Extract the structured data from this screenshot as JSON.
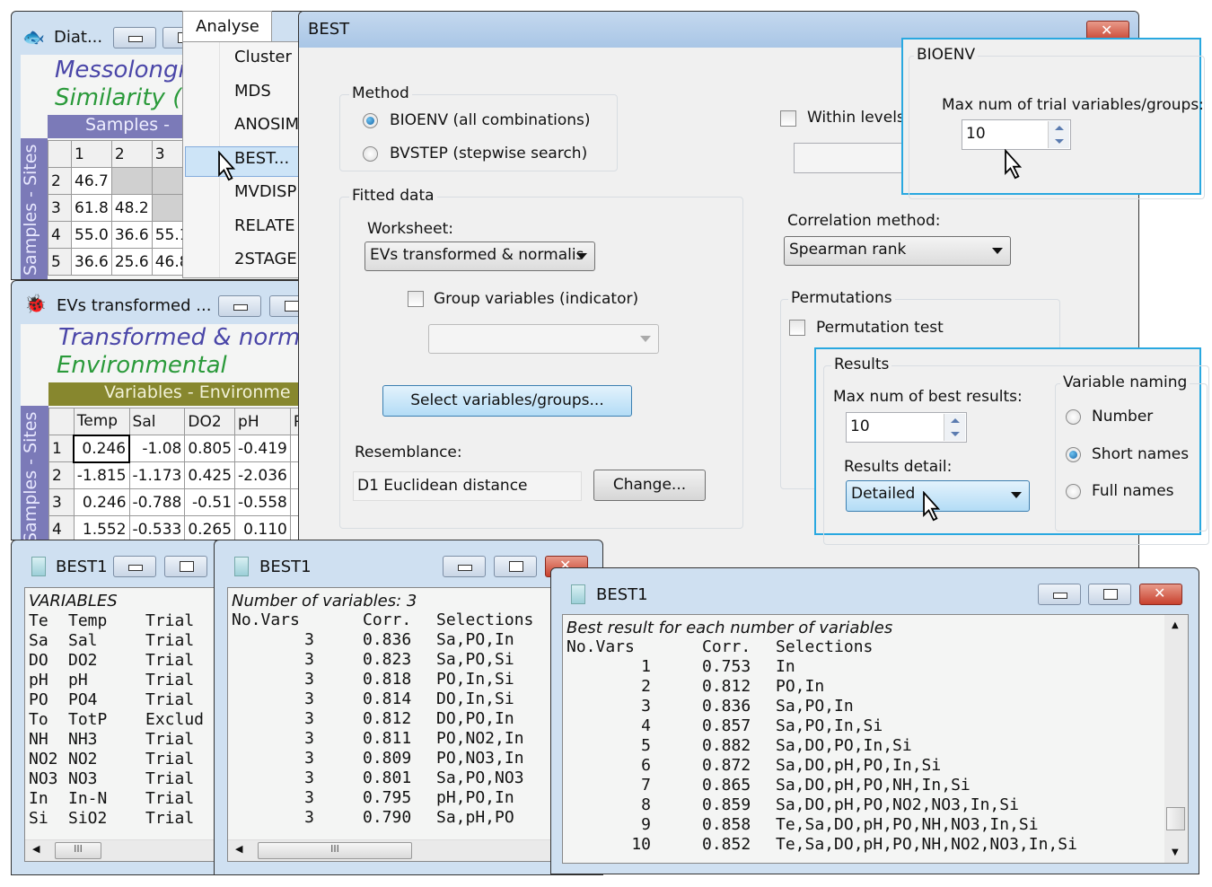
{
  "diat_window": {
    "title": "Diat...",
    "heading1": "Messolongi",
    "heading2": "Similarity (",
    "col_header": "Samples -",
    "row_header": "Samples - Sites",
    "columns": [
      "1",
      "2",
      "3"
    ],
    "rows": [
      {
        "label": "2",
        "cells": [
          "46.7",
          "",
          ""
        ]
      },
      {
        "label": "3",
        "cells": [
          "61.8",
          "48.2",
          ""
        ]
      },
      {
        "label": "4",
        "cells": [
          "55.0",
          "36.6",
          "55.1"
        ]
      },
      {
        "label": "5",
        "cells": [
          "36.6",
          "25.6",
          "46.8"
        ]
      }
    ]
  },
  "analyse_menu": {
    "title": "Analyse",
    "items": [
      "Cluster",
      "MDS",
      "ANOSIM",
      "BEST...",
      "MVDISP",
      "RELATE",
      "2STAGE"
    ],
    "highlighted": "BEST..."
  },
  "evs_window": {
    "title": "EVs transformed ...",
    "heading1": "Transformed & norma",
    "heading2": "Environmental",
    "col_header": "Variables - Environme",
    "row_header": "Samples - Sites",
    "columns": [
      "Temp",
      "Sal",
      "DO2",
      "pH",
      "P"
    ],
    "rows": [
      {
        "label": "1",
        "cells": [
          "0.246",
          "-1.08",
          "0.805",
          "-0.419",
          "-"
        ]
      },
      {
        "label": "2",
        "cells": [
          "-1.815",
          "-1.173",
          "0.425",
          "-2.036",
          "-"
        ]
      },
      {
        "label": "3",
        "cells": [
          "0.246",
          "-0.788",
          "-0.51",
          "-0.558",
          "-"
        ]
      },
      {
        "label": "4",
        "cells": [
          "1.552",
          "-0.533",
          "0.265",
          "0.110",
          ""
        ]
      }
    ]
  },
  "best_dialog": {
    "title": "BEST",
    "method": {
      "label": "Method",
      "options": [
        "BIOENV (all combinations)",
        "BVSTEP (stepwise search)"
      ],
      "selected": 0
    },
    "fitted_data": {
      "label": "Fitted data",
      "worksheet_label": "Worksheet:",
      "worksheet_value": "EVs transformed & normalis",
      "group_variables_label": "Group variables (indicator)",
      "group_variables_checked": false,
      "group_dropdown_value": "",
      "select_button": "Select variables/groups...",
      "resemblance_label": "Resemblance:",
      "resemblance_value": "D1 Euclidean distance",
      "change_button": "Change..."
    },
    "within_levels_label": "Within levels",
    "within_levels_checked": false,
    "correlation_label": "Correlation method:",
    "correlation_value": "Spearman rank",
    "permutations": {
      "label": "Permutations",
      "test_label": "Permutation test",
      "test_checked": false
    },
    "bioenv": {
      "label": "BIOENV",
      "max_trial_label": "Max num of trial variables/groups:",
      "max_trial_value": "10"
    },
    "results": {
      "label": "Results",
      "max_best_label": "Max num of best results:",
      "max_best_value": "10",
      "detail_label": "Results detail:",
      "detail_value": "Detailed",
      "naming": {
        "label": "Variable naming",
        "options": [
          "Number",
          "Short names",
          "Full names"
        ],
        "selected": 1
      }
    }
  },
  "best1_vars": {
    "title": "BEST1",
    "heading": "VARIABLES",
    "rows": [
      [
        "Te",
        "Temp",
        "Trial"
      ],
      [
        "Sa",
        "Sal",
        "Trial"
      ],
      [
        "DO",
        "DO2",
        "Trial"
      ],
      [
        "pH",
        "pH",
        "Trial"
      ],
      [
        "PO",
        "PO4",
        "Trial"
      ],
      [
        "To",
        "TotP",
        "Exclud"
      ],
      [
        "NH",
        "NH3",
        "Trial"
      ],
      [
        "NO2",
        "NO2",
        "Trial"
      ],
      [
        "NO3",
        "NO3",
        "Trial"
      ],
      [
        "In",
        "In-N",
        "Trial"
      ],
      [
        "Si",
        "SiO2",
        "Trial"
      ]
    ]
  },
  "best1_three": {
    "title": "BEST1",
    "heading": "Number of variables: 3",
    "columns": [
      "No.Vars",
      "Corr.",
      "Selections"
    ],
    "rows": [
      [
        "3",
        "0.836",
        "Sa,PO,In"
      ],
      [
        "3",
        "0.823",
        "Sa,PO,Si"
      ],
      [
        "3",
        "0.818",
        "PO,In,Si"
      ],
      [
        "3",
        "0.814",
        "DO,In,Si"
      ],
      [
        "3",
        "0.812",
        "DO,PO,In"
      ],
      [
        "3",
        "0.811",
        "PO,NO2,In"
      ],
      [
        "3",
        "0.809",
        "PO,NO3,In"
      ],
      [
        "3",
        "0.801",
        "Sa,PO,NO3"
      ],
      [
        "3",
        "0.795",
        "pH,PO,In"
      ],
      [
        "3",
        "0.790",
        "Sa,pH,PO"
      ]
    ]
  },
  "best1_best": {
    "title": "BEST1",
    "heading": "Best result for each number of variables",
    "columns": [
      "No.Vars",
      "Corr.",
      "Selections"
    ],
    "rows": [
      [
        "1",
        "0.753",
        "In"
      ],
      [
        "2",
        "0.812",
        "PO,In"
      ],
      [
        "3",
        "0.836",
        "Sa,PO,In"
      ],
      [
        "4",
        "0.857",
        "Sa,PO,In,Si"
      ],
      [
        "5",
        "0.882",
        "Sa,DO,PO,In,Si"
      ],
      [
        "6",
        "0.872",
        "Sa,DO,pH,PO,In,Si"
      ],
      [
        "7",
        "0.865",
        "Sa,DO,pH,PO,NH,In,Si"
      ],
      [
        "8",
        "0.859",
        "Sa,DO,pH,PO,NO2,NO3,In,Si"
      ],
      [
        "9",
        "0.858",
        "Te,Sa,DO,pH,PO,NH,NO3,In,Si"
      ],
      [
        "10",
        "0.852",
        "Te,Sa,DO,pH,PO,NH,NO2,NO3,In,Si"
      ]
    ]
  },
  "colors": {
    "callout": "#29a8e0",
    "samples_bar": "#7b7ab8",
    "variables_bar": "#87872e",
    "title_blue": "#4a46a8",
    "title_green": "#2a9a3a"
  }
}
